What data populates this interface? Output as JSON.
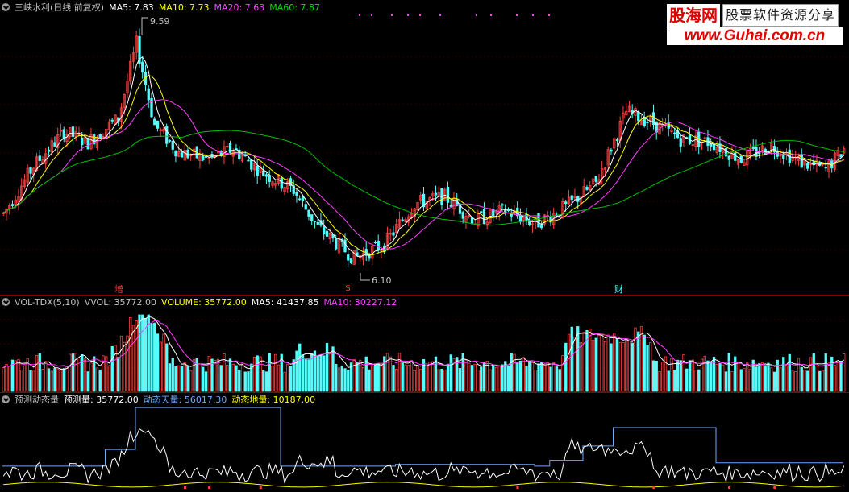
{
  "main": {
    "title": "三峡水利(日线 前复权)",
    "ma5": "MA5: 7.83",
    "ma10": "MA10: 7.73",
    "ma20": "MA20: 7.63",
    "ma60": "MA60: 7.87",
    "high_label": "9.59",
    "low_label": "6.10",
    "markers": [
      "增",
      "$",
      "财"
    ]
  },
  "volume": {
    "title": "VOL-TDX(5,10)",
    "vvol": "VVOL: 35772.00",
    "volume": "VOLUME: 35772.00",
    "ma5": "MA5: 41437.85",
    "ma10": "MA10: 30227.12"
  },
  "indicator": {
    "title": "预测动态量",
    "forecast": "预测量: 35772.00",
    "sky": "动态天量: 56017.30",
    "ground": "动态地量: 10187.00"
  },
  "logo": {
    "name": "股海网",
    "tagline": "股票软件资源分享",
    "url": "www.Guhai.com.cn"
  },
  "colors": {
    "up": "#ff4040",
    "down": "#54ffff",
    "ma5": "#ffffff",
    "ma10": "#ffff00",
    "ma20": "#ff40ff",
    "ma60": "#00c000",
    "sky": "#6fa8ff",
    "ground": "#ffff00"
  }
}
